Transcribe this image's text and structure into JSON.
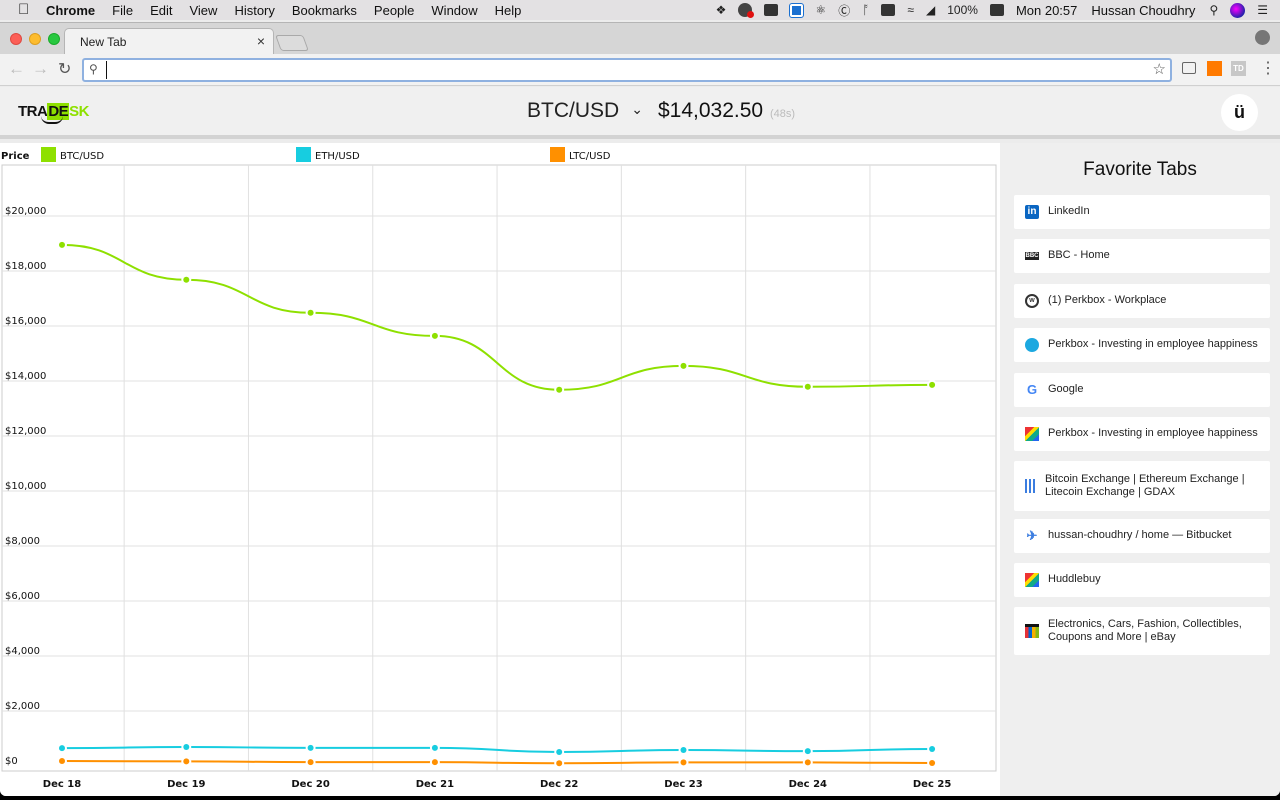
{
  "menubar": {
    "app_name": "Chrome",
    "menus": [
      "File",
      "Edit",
      "View",
      "History",
      "Bookmarks",
      "People",
      "Window",
      "Help"
    ],
    "battery": "100%",
    "clock": "Mon 20:57",
    "user": "Hussan Choudhry"
  },
  "browser": {
    "tab_title": "New Tab",
    "tab_close": "×",
    "address_value": "",
    "extension_td": "TD"
  },
  "app": {
    "logo": {
      "part1": "TRA",
      "part2": "DE",
      "part3": "SK"
    },
    "pair": "BTC/USD",
    "price": "$14,032.50",
    "age": "(48s)",
    "user_icon": "ü"
  },
  "sidebar": {
    "title": "Favorite Tabs",
    "items": [
      {
        "label": "LinkedIn",
        "icon": "linkedin-icon"
      },
      {
        "label": "BBC - Home",
        "icon": "bbc-icon"
      },
      {
        "label": "(1) Perkbox - Workplace",
        "icon": "workplace-icon"
      },
      {
        "label": "Perkbox - Investing in employee happiness",
        "icon": "perkbox-icon"
      },
      {
        "label": "Google",
        "icon": "google-icon"
      },
      {
        "label": "Perkbox - Investing in employee happiness",
        "icon": "huddlebuy-icon"
      },
      {
        "label": "Bitcoin Exchange | Ethereum Exchange | Litecoin Exchange | GDAX",
        "icon": "gdax-icon"
      },
      {
        "label": "hussan-choudhry / home — Bitbucket",
        "icon": "bitbucket-icon"
      },
      {
        "label": "Huddlebuy",
        "icon": "huddlebuy-icon"
      },
      {
        "label": "Electronics, Cars, Fashion, Collectibles, Coupons and More | eBay",
        "icon": "ebay-icon"
      }
    ]
  },
  "chart_data": {
    "type": "line",
    "title": "",
    "ylabel": "Price",
    "xlabel": "",
    "categories": [
      "Dec 18",
      "Dec 19",
      "Dec 20",
      "Dec 21",
      "Dec 22",
      "Dec 23",
      "Dec 24",
      "Dec 25"
    ],
    "ylim": [
      0,
      22000
    ],
    "yticks": [
      0,
      2000,
      4000,
      6000,
      8000,
      10000,
      12000,
      14000,
      16000,
      18000,
      20000
    ],
    "ytick_labels": [
      "$0",
      "$2,000",
      "$4,000",
      "$6,000",
      "$8,000",
      "$10,000",
      "$12,000",
      "$14,000",
      "$16,000",
      "$18,000",
      "$20,000"
    ],
    "grid": true,
    "legend_position": "top",
    "series": [
      {
        "name": "BTC/USD",
        "color": "#8ee000",
        "values": [
          18950,
          17680,
          16480,
          15640,
          13680,
          14550,
          13790,
          13860
        ]
      },
      {
        "name": "ETH/USD",
        "color": "#17cde0",
        "values": [
          650,
          690,
          660,
          660,
          510,
          580,
          540,
          620
        ]
      },
      {
        "name": "LTC/USD",
        "color": "#ff9000",
        "values": [
          180,
          170,
          140,
          140,
          100,
          130,
          130,
          110
        ]
      }
    ]
  }
}
